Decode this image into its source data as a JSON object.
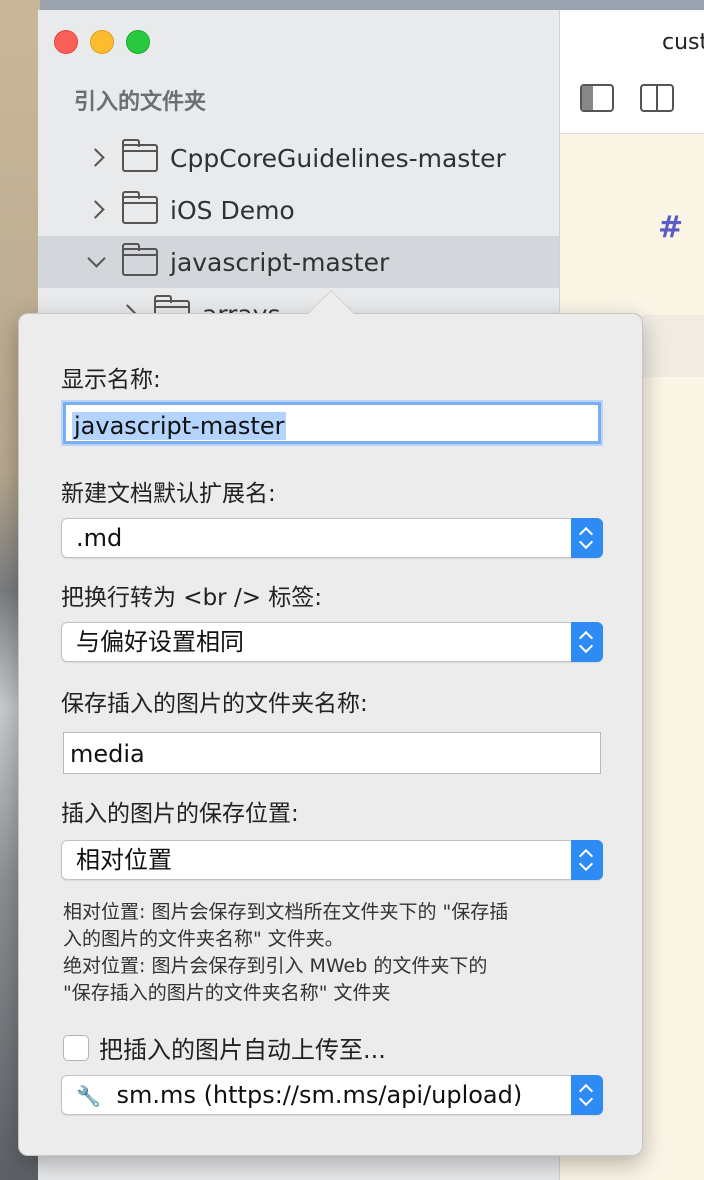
{
  "sidebar": {
    "header": "引入的文件夹",
    "items": [
      {
        "label": "CppCoreGuidelines-master",
        "expanded": false
      },
      {
        "label": "iOS Demo",
        "expanded": false
      },
      {
        "label": "javascript-master",
        "expanded": true,
        "selected": true
      }
    ],
    "sub_item_partial": "arrays"
  },
  "editor": {
    "tab_title": "cust",
    "heading_marker": "#"
  },
  "popover": {
    "display_name_label": "显示名称:",
    "display_name_value": "javascript-master",
    "default_ext_label": "新建文档默认扩展名:",
    "default_ext_value": ".md",
    "br_label": "把换行转为 <br /> 标签:",
    "br_value": "与偏好设置相同",
    "image_folder_label": "保存插入的图片的文件夹名称:",
    "image_folder_value": "media",
    "image_location_label": "插入的图片的保存位置:",
    "image_location_value": "相对位置",
    "help_line1": "相对位置: 图片会保存到文档所在文件夹下的 \"保存插",
    "help_line2": "入的图片的文件夹名称\" 文件夹。",
    "help_line3": "绝对位置: 图片会保存到引入 MWeb 的文件夹下的",
    "help_line4": "\"保存插入的图片的文件夹名称\" 文件夹",
    "auto_upload_label": "把插入的图片自动上传至...",
    "auto_upload_checked": false,
    "upload_service_value": "sm.ms (https://sm.ms/api/upload)"
  },
  "colors": {
    "accent": "#2d8bf3",
    "selection": "#b4d4fd",
    "heading_hash": "#5a5ec4"
  }
}
